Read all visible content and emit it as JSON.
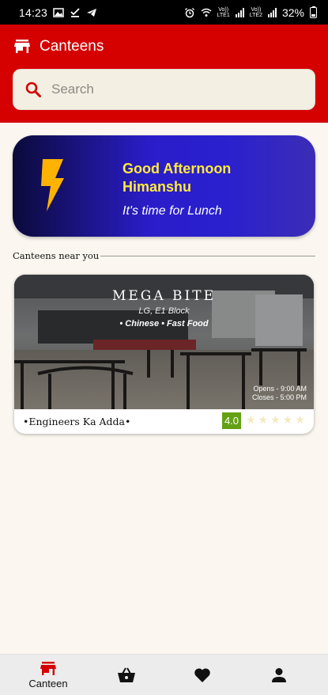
{
  "status_bar": {
    "time": "14:23",
    "network1": "Vo))\nLTE1",
    "network2": "Vo))\nLTE2",
    "battery": "32%"
  },
  "header": {
    "title": "Canteens",
    "icon": "store-icon"
  },
  "search": {
    "placeholder": "Search",
    "value": ""
  },
  "greeting": {
    "line1": "Good Afternoon",
    "line2": "Himanshu",
    "subtitle": "It's time for Lunch"
  },
  "section": {
    "label": "Canteens near you"
  },
  "canteens": [
    {
      "name": "MEGA BITE",
      "location": "LG, E1 Block",
      "tags": "• Chinese • Fast Food",
      "opens": "Opens -  9:00 AM",
      "closes": "Closes - 5:00 PM",
      "owner": "•Engineers Ka Adda•",
      "rating": "4.0",
      "stars_filled": 0,
      "stars_total": 5
    }
  ],
  "bottom_nav": {
    "items": [
      {
        "label": "Canteen",
        "icon": "store-icon",
        "active": true
      },
      {
        "label": "",
        "icon": "basket-icon",
        "active": false
      },
      {
        "label": "",
        "icon": "heart-icon",
        "active": false
      },
      {
        "label": "",
        "icon": "person-icon",
        "active": false
      }
    ]
  },
  "colors": {
    "brand_red": "#d50000",
    "greeting_yellow": "#ffea3b",
    "rating_green": "#64a014",
    "background": "#fbf7f0"
  }
}
